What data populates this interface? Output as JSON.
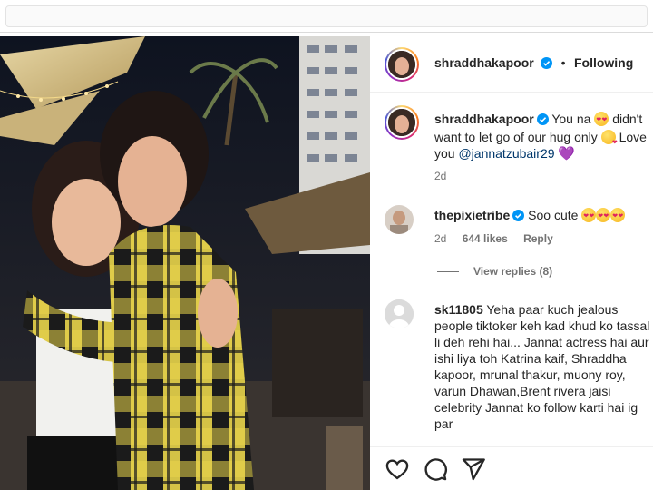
{
  "post": {
    "author": {
      "username": "shraddhakapoor",
      "verified": true,
      "follow_status": "Following"
    },
    "caption": {
      "username": "shraddhakapoor",
      "text_part1": "You na ",
      "text_part2": " didn't want to let go of our hug only ",
      "text_part3": " Love you ",
      "mention": "@jannatzubair29",
      "timestamp": "2d"
    },
    "comments": [
      {
        "username": "thepixietribe",
        "verified": true,
        "text": "Soo cute ",
        "time": "2d",
        "likes": "644 likes",
        "reply_label": "Reply",
        "view_replies": "View replies (8)"
      },
      {
        "username": "sk11805",
        "text": "Yeha paar kuch jealous people tiktoker keh kad khud ko tassal li deh rehi hai... Jannat actress hai aur ishi liya toh Katrina kaif, Shraddha kapoor, mrunal thakur, muony roy, varun Dhawan,Brent rivera jaisi celebrity Jannat ko follow karti hai ig par"
      }
    ]
  },
  "icons": {
    "verified": "verified-badge-icon",
    "like": "heart-icon",
    "comment": "comment-icon",
    "share": "paper-plane-icon"
  },
  "colors": {
    "verified_blue": "#0095f6",
    "mention": "#00376b",
    "muted_text": "#737373"
  }
}
